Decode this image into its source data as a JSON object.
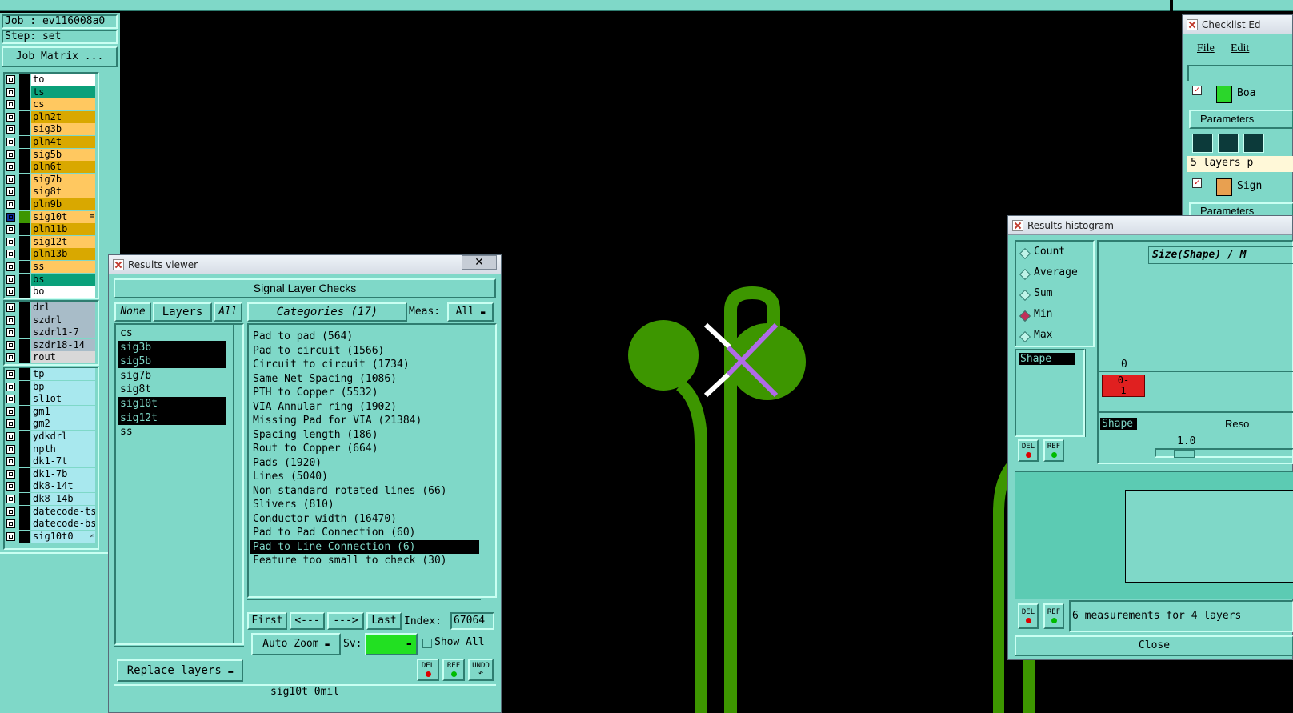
{
  "top": {
    "job_label": "Job : ev116008a0",
    "step_label": "Step: set",
    "job_matrix_button": "Job Matrix ..."
  },
  "layers": {
    "group1": [
      {
        "name": "to",
        "color": "#ffffff"
      },
      {
        "name": "ts",
        "color": "#0aa07a"
      },
      {
        "name": "cs",
        "color": "#ffc860"
      },
      {
        "name": "pln2t",
        "color": "#d9a800"
      },
      {
        "name": "sig3b",
        "color": "#ffc860"
      },
      {
        "name": "pln4t",
        "color": "#d9a800"
      },
      {
        "name": "sig5b",
        "color": "#ffc860"
      },
      {
        "name": "pln6t",
        "color": "#d9a800"
      },
      {
        "name": "sig7b",
        "color": "#ffc860"
      },
      {
        "name": "sig8t",
        "color": "#ffc860"
      },
      {
        "name": "pln9b",
        "color": "#d9a800"
      },
      {
        "name": "sig10t",
        "color": "#ffc860",
        "marker": "≡"
      },
      {
        "name": "pln11b",
        "color": "#d9a800"
      },
      {
        "name": "sig12t",
        "color": "#ffc860"
      },
      {
        "name": "pln13b",
        "color": "#d9a800"
      },
      {
        "name": "ss",
        "color": "#ffc860"
      },
      {
        "name": "bs",
        "color": "#0aa07a"
      },
      {
        "name": "bo",
        "color": "#ffffff"
      }
    ],
    "group2": [
      {
        "name": "drl",
        "color": "#a8bcc8"
      },
      {
        "name": "szdrl",
        "color": "#a8bcc8"
      },
      {
        "name": "szdrl1-7",
        "color": "#a8bcc8"
      },
      {
        "name": "szdr18-14",
        "color": "#a8bcc8"
      },
      {
        "name": "rout",
        "color": "#d8d8d8"
      }
    ],
    "group3": [
      {
        "name": "tp",
        "color": "#a8e8ee"
      },
      {
        "name": "bp",
        "color": "#a8e8ee"
      },
      {
        "name": "sl1ot",
        "color": "#a8e8ee"
      },
      {
        "name": "gm1",
        "color": "#a8e8ee"
      },
      {
        "name": "gm2",
        "color": "#a8e8ee"
      },
      {
        "name": "ydkdrl",
        "color": "#a8e8ee"
      },
      {
        "name": "npth",
        "color": "#a8e8ee"
      },
      {
        "name": "dk1-7t",
        "color": "#a8e8ee"
      },
      {
        "name": "dk1-7b",
        "color": "#a8e8ee"
      },
      {
        "name": "dk8-14t",
        "color": "#a8e8ee"
      },
      {
        "name": "dk8-14b",
        "color": "#a8e8ee"
      },
      {
        "name": "datecode-ts",
        "color": "#a8e8ee"
      },
      {
        "name": "datecode-bs",
        "color": "#a8e8ee"
      },
      {
        "name": "sig10t0",
        "color": "#a8e8ee",
        "marker": "✍"
      }
    ]
  },
  "results_viewer": {
    "window_title": "Results viewer",
    "close_glyph": "✕",
    "section_title": "Signal Layer Checks",
    "none_btn": "None",
    "layers_btn": "Layers",
    "all_btn": "All",
    "categories_btn": "Categories (17)",
    "meas_label": "Meas:",
    "meas_value": "All",
    "layer_list": [
      {
        "name": "cs",
        "selected": false
      },
      {
        "name": "sig3b",
        "selected": true
      },
      {
        "name": "sig5b",
        "selected": true
      },
      {
        "name": "sig7b",
        "selected": false
      },
      {
        "name": "sig8t",
        "selected": false
      },
      {
        "name": "sig10t",
        "selected": true
      },
      {
        "name": "sig12t",
        "selected": true
      },
      {
        "name": "ss",
        "selected": false
      }
    ],
    "categories": [
      {
        "label": "Pad to pad (564)",
        "selected": false
      },
      {
        "label": "Pad to circuit (1566)",
        "selected": false
      },
      {
        "label": "Circuit to circuit (1734)",
        "selected": false
      },
      {
        "label": "Same Net Spacing (1086)",
        "selected": false
      },
      {
        "label": "PTH to Copper (5532)",
        "selected": false
      },
      {
        "label": "VIA Annular ring (1902)",
        "selected": false
      },
      {
        "label": "Missing Pad for VIA (21384)",
        "selected": false
      },
      {
        "label": "Spacing length (186)",
        "selected": false
      },
      {
        "label": "Rout to Copper (664)",
        "selected": false
      },
      {
        "label": "Pads (1920)",
        "selected": false
      },
      {
        "label": "Lines (5040)",
        "selected": false
      },
      {
        "label": "Non standard rotated lines (66)",
        "selected": false
      },
      {
        "label": "Slivers (810)",
        "selected": false
      },
      {
        "label": "Conductor width (16470)",
        "selected": false
      },
      {
        "label": "Pad to Pad Connection (60)",
        "selected": false
      },
      {
        "label": "Pad to Line Connection (6)",
        "selected": true
      },
      {
        "label": "Feature too small to check (30)",
        "selected": false
      }
    ],
    "first_btn": "First",
    "prev_btn": "<---",
    "next_btn": "--->",
    "last_btn": "Last",
    "index_label": "Index:",
    "index_value": "67064",
    "auto_zoom_btn": "Auto Zoom",
    "sv_label": "Sv:",
    "sv_color": "#22e022",
    "show_all_label": "Show All",
    "replace_layers_btn": "Replace layers",
    "del_btn": "DEL",
    "ref_btn": "REF",
    "undo_btn": "UNDO",
    "status_text": "sig10t 0mil"
  },
  "checklist": {
    "window_title": "Checklist Ed",
    "menu_file": "File",
    "menu_edit": "Edit",
    "row1_label": "Boa",
    "params_btn": "Parameters",
    "layers_field": "5 layers p",
    "row2_label": "Sign",
    "params_btn2": "Parameters"
  },
  "histogram": {
    "window_title": "Results histogram",
    "modes": [
      {
        "label": "Count",
        "selected": false
      },
      {
        "label": "Average",
        "selected": false
      },
      {
        "label": "Sum",
        "selected": false
      },
      {
        "label": "Min",
        "selected": true
      },
      {
        "label": "Max",
        "selected": false
      }
    ],
    "plot_title": "Size(Shape) / M",
    "axis_zero": "0",
    "bar_label": "0-\n1",
    "shape_list_item": "Shape",
    "shape_label": "Shape",
    "reso_label": "Reso",
    "reso_value": "1.0",
    "del_btn": "DEL",
    "ref_btn": "REF",
    "summary": "6 measurements for 4 layers",
    "close_btn": "Close"
  },
  "colors": {
    "panel": "#7fd8c8",
    "trace": "#3d9600",
    "marker": "#b06ae8",
    "highlight": "#000000"
  }
}
